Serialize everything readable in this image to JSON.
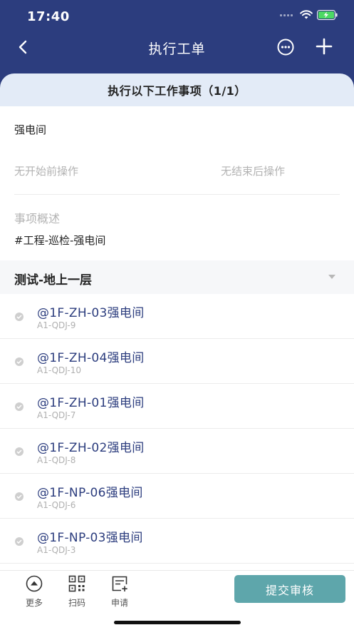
{
  "status_bar": {
    "time": "17:40"
  },
  "nav": {
    "title": "执行工单"
  },
  "section": {
    "title": "执行以下工作事项（1/1）"
  },
  "work_item": {
    "location": "强电间",
    "pre_operation": "无开始前操作",
    "post_operation": "无结束后操作",
    "description_label": "事项概述",
    "description_value": "#工程-巡检-强电间"
  },
  "group": {
    "title": "测试-地上一层"
  },
  "tasks": [
    {
      "name": "@1F-ZH-03强电间",
      "code": "A1-QDJ-9"
    },
    {
      "name": "@1F-ZH-04强电间",
      "code": "A1-QDJ-10"
    },
    {
      "name": "@1F-ZH-01强电间",
      "code": "A1-QDJ-7"
    },
    {
      "name": "@1F-ZH-02强电间",
      "code": "A1-QDJ-8"
    },
    {
      "name": "@1F-NP-06强电间",
      "code": "A1-QDJ-6"
    },
    {
      "name": "@1F-NP-03强电间",
      "code": "A1-QDJ-3"
    }
  ],
  "toolbar": {
    "more_label": "更多",
    "scan_label": "扫码",
    "apply_label": "申请",
    "submit_label": "提交审核"
  },
  "colors": {
    "header_bg": "#2c3d7e",
    "section_bg": "#e3ebf7",
    "task_text": "#2c3d7e",
    "submit_bg": "#5ea6ab"
  }
}
